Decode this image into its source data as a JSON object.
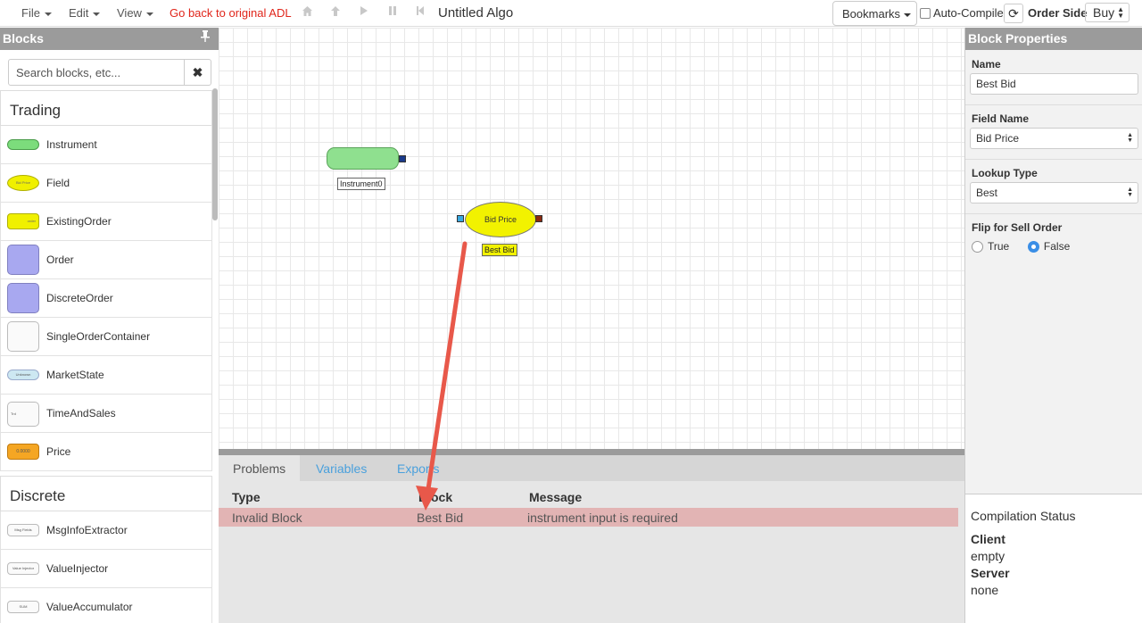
{
  "menubar": {
    "file": "File",
    "edit": "Edit",
    "view": "View",
    "go_back": "Go back to original ADL",
    "algo_title": "Untitled Algo",
    "bookmarks": "Bookmarks",
    "auto_compile": "Auto-Compile",
    "order_side_label": "Order Side",
    "order_side_value": "Buy",
    "toolbar_icons": [
      "home-icon",
      "up-arrow-icon",
      "play-icon",
      "pause-icon",
      "step-back-icon",
      "refresh-icon"
    ]
  },
  "blocks_panel": {
    "title": "Blocks",
    "search_placeholder": "Search blocks, etc...",
    "groups": [
      {
        "name": "Trading",
        "items": [
          {
            "label": "Instrument",
            "thumb_text": ""
          },
          {
            "label": "Field",
            "thumb_text": "Bid Price"
          },
          {
            "label": "ExistingOrder",
            "thumb_text": "order"
          },
          {
            "label": "Order",
            "thumb_text": ""
          },
          {
            "label": "DiscreteOrder",
            "thumb_text": ""
          },
          {
            "label": "SingleOrderContainer",
            "thumb_text": ""
          },
          {
            "label": "MarketState",
            "thumb_text": "Unknown"
          },
          {
            "label": "TimeAndSales",
            "thumb_text": "Trd"
          },
          {
            "label": "Price",
            "thumb_text": "0.0000"
          }
        ]
      },
      {
        "name": "Discrete",
        "items": [
          {
            "label": "MsgInfoExtractor",
            "thumb_text": "Msg Fields"
          },
          {
            "label": "ValueInjector",
            "thumb_text": "Value Injector"
          },
          {
            "label": "ValueAccumulator",
            "thumb_text": "SUM"
          }
        ]
      }
    ]
  },
  "canvas": {
    "instrument_node": {
      "label": "Instrument0"
    },
    "field_node": {
      "text": "Bid Price",
      "label": "Best Bid"
    }
  },
  "bottom_panel": {
    "tabs": [
      "Problems",
      "Variables",
      "Exports"
    ],
    "columns": [
      "Type",
      "Block",
      "Message"
    ],
    "rows": [
      {
        "type": "Invalid Block",
        "block": "Best Bid",
        "message": "instrument input is required"
      }
    ]
  },
  "properties": {
    "title": "Block Properties",
    "name_label": "Name",
    "name_value": "Best Bid",
    "field_name_label": "Field Name",
    "field_name_value": "Bid Price",
    "lookup_type_label": "Lookup Type",
    "lookup_type_value": "Best",
    "flip_label": "Flip for Sell Order",
    "flip_options": [
      "True",
      "False"
    ],
    "flip_selected": "False"
  },
  "compilation": {
    "title": "Compilation Status",
    "client_label": "Client",
    "client_value": "empty",
    "server_label": "Server",
    "server_value": "none"
  },
  "colors": {
    "accent_red": "#e0261b",
    "link_blue": "#4aa0dc",
    "error_row": "#e2b4b4",
    "annotation_arrow": "#e8584a"
  }
}
